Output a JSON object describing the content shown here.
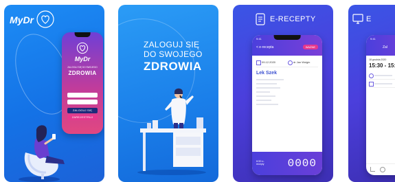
{
  "card1": {
    "logo": "MyDr",
    "phone_logo": "MyDr",
    "phone_subtitle": "ZALOGUJ SIĘ DO SWOJEGO",
    "phone_title": "ZDROWIA",
    "login_button": "ZALOGUJ SIĘ",
    "register_button": "ZAREJESTRUJ"
  },
  "card2": {
    "headline_line1": "ZALOGUJ SIĘ",
    "headline_line2": "DO SWOJEGO",
    "headline_line3": "ZDROWIA"
  },
  "card3": {
    "title": "E-RECEPTY",
    "back_label": "< e-recepta",
    "status_badge": "WAŻNE",
    "date_value": "09.12.2020",
    "doctor_label": "dr Jan Wolgin",
    "patient_name": "Lek Szek",
    "counter_value": "0000",
    "counter_label": "KOD e-recepty",
    "time": "9:41"
  },
  "card4": {
    "title": "E",
    "time": "9:41",
    "date_line": "18 grudnia 2020",
    "time_range": "15:30 - 15:4",
    "tab_label": "Zal"
  },
  "colors": {
    "blue": "#1d8cf5",
    "purple": "#4b3fdc",
    "pink": "#e6388d",
    "navy": "#1d2a7a"
  }
}
